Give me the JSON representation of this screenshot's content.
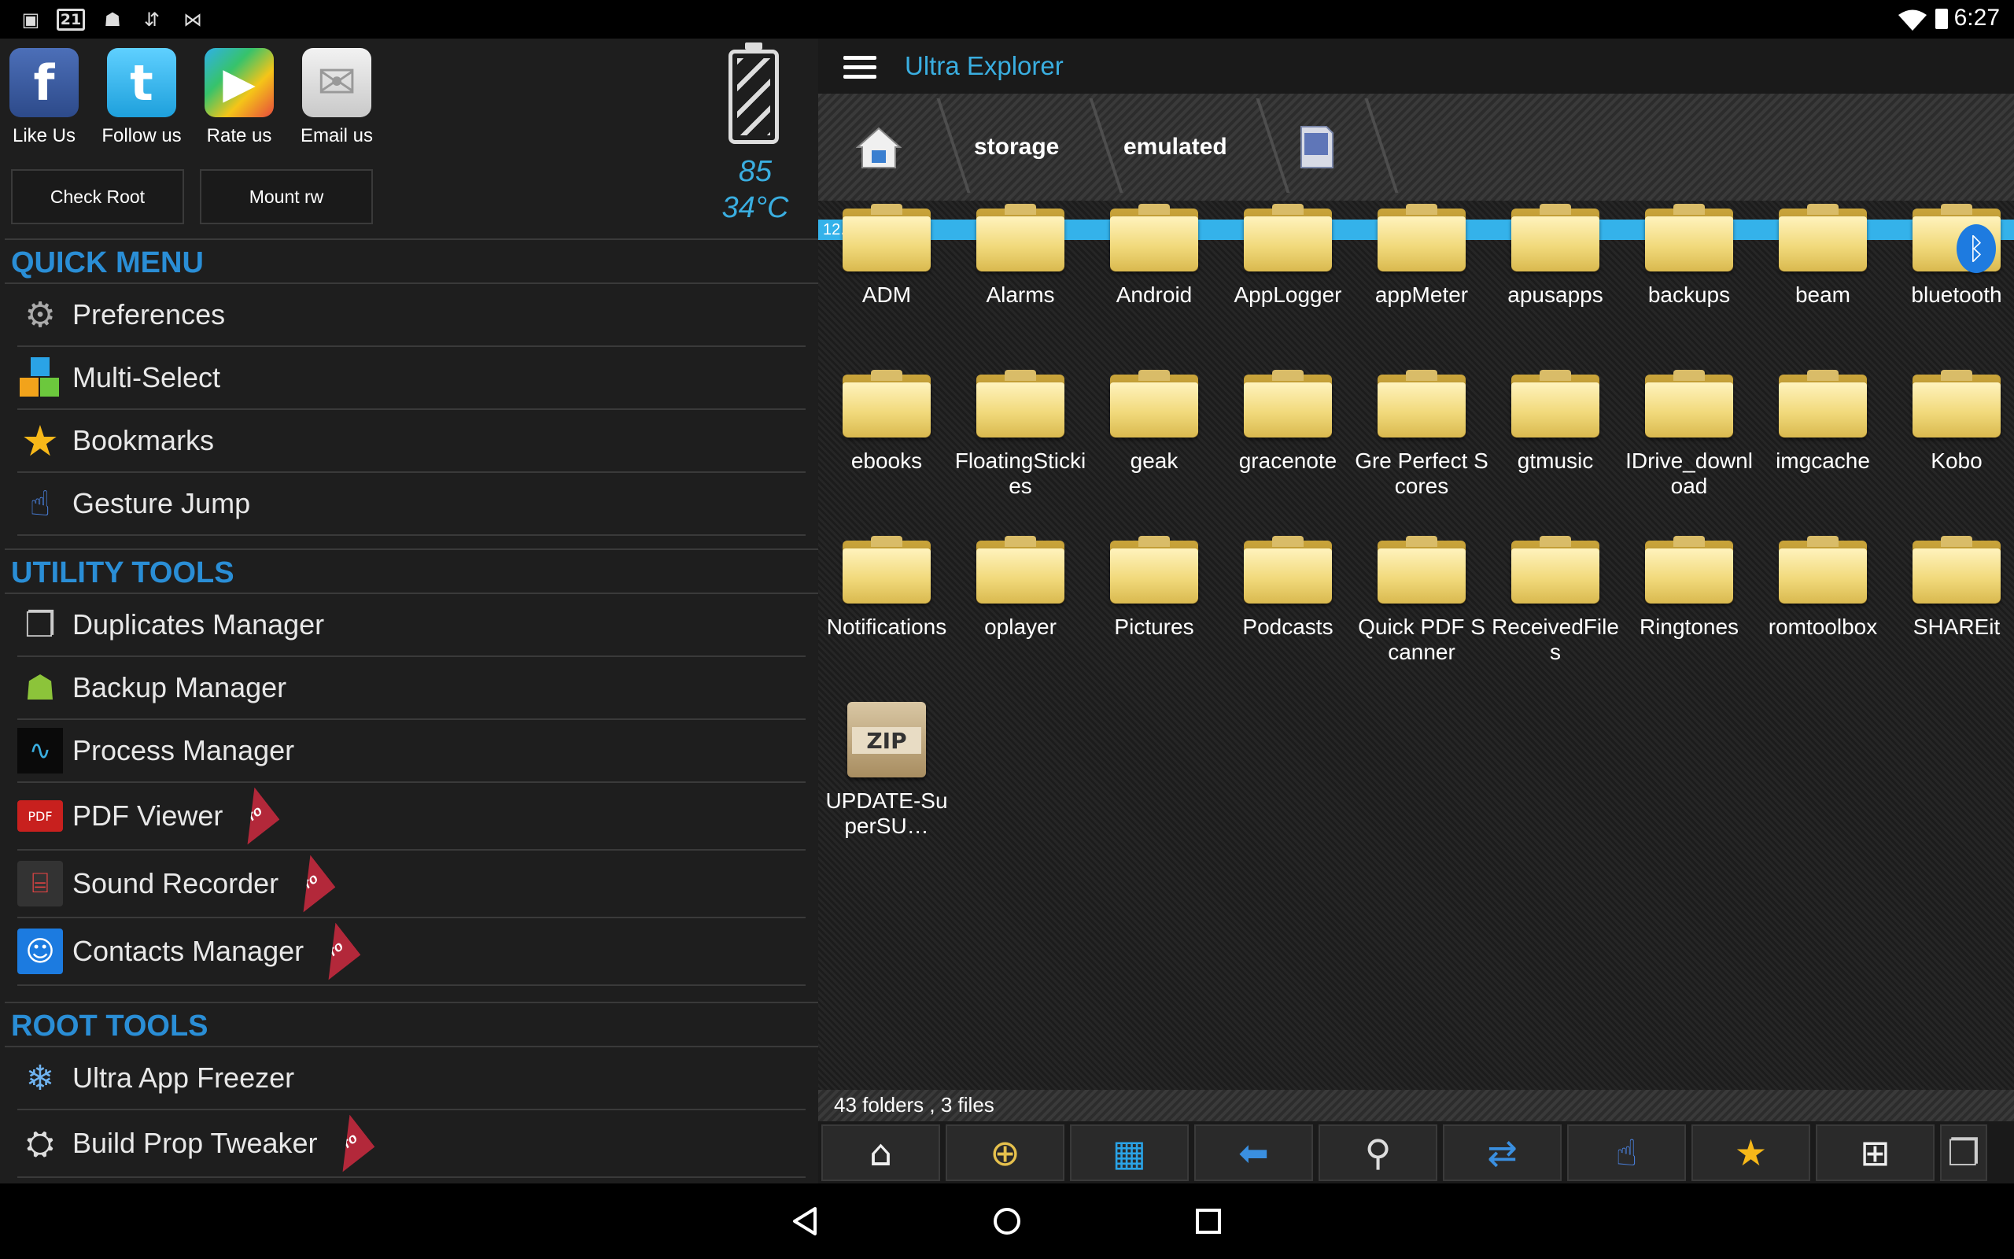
{
  "status_bar": {
    "time": "6:27",
    "notifications": [
      "image-icon",
      "calendar-icon",
      "android-icon",
      "transfer-icon",
      "bow-icon"
    ],
    "calendar_day": "21"
  },
  "left_panel": {
    "social": [
      {
        "label": "Like Us",
        "icon": "facebook-icon",
        "glyph": "f",
        "color": "#3b5998"
      },
      {
        "label": "Follow us",
        "icon": "twitter-icon",
        "glyph": "t",
        "color": "#2fb4f0"
      },
      {
        "label": "Rate us",
        "icon": "play-store-icon",
        "glyph": "▶",
        "color": "#5a9e3a"
      },
      {
        "label": "Email us",
        "icon": "email-icon",
        "glyph": "✉",
        "color": "#d8d8d8"
      }
    ],
    "check_root_label": "Check Root",
    "mount_label": "Mount rw",
    "battery_level": "85",
    "temperature": "34°C",
    "sections": [
      {
        "title": "QUICK MENU",
        "items": [
          {
            "label": "Preferences",
            "icon": "gear-icon",
            "pro": false
          },
          {
            "label": "Multi-Select",
            "icon": "blocks-icon",
            "pro": false
          },
          {
            "label": "Bookmarks",
            "icon": "star-icon",
            "pro": false
          },
          {
            "label": "Gesture Jump",
            "icon": "hand-icon",
            "pro": false
          }
        ]
      },
      {
        "title": "UTILITY TOOLS",
        "items": [
          {
            "label": "Duplicates Manager",
            "icon": "duplicates-icon",
            "pro": false
          },
          {
            "label": "Backup Manager",
            "icon": "android-icon",
            "pro": false
          },
          {
            "label": "Process Manager",
            "icon": "pulse-icon",
            "pro": false
          },
          {
            "label": "PDF Viewer",
            "icon": "pdf-icon",
            "pro": true
          },
          {
            "label": "Sound Recorder",
            "icon": "cassette-icon",
            "pro": true
          },
          {
            "label": "Contacts Manager",
            "icon": "contacts-icon",
            "pro": true
          }
        ]
      },
      {
        "title": "ROOT TOOLS",
        "items": [
          {
            "label": "Ultra App Freezer",
            "icon": "freezer-icon",
            "pro": false
          },
          {
            "label": "Build Prop Tweaker",
            "icon": "prop-icon",
            "pro": true
          }
        ]
      }
    ],
    "pro_badge": "Pro"
  },
  "right_panel": {
    "app_title": "Ultra Explorer",
    "breadcrumb": [
      {
        "type": "icon",
        "icon": "home-icon"
      },
      {
        "type": "text",
        "label": "storage"
      },
      {
        "type": "text",
        "label": "emulated"
      },
      {
        "type": "icon",
        "icon": "sd-card-icon"
      }
    ],
    "storage_used": "12.67 Gb used",
    "items": [
      {
        "name": "ADM",
        "type": "folder"
      },
      {
        "name": "Alarms",
        "type": "folder"
      },
      {
        "name": "Android",
        "type": "folder"
      },
      {
        "name": "AppLogger",
        "type": "folder"
      },
      {
        "name": "appMeter",
        "type": "folder"
      },
      {
        "name": "apusapps",
        "type": "folder"
      },
      {
        "name": "backups",
        "type": "folder"
      },
      {
        "name": "beam",
        "type": "folder"
      },
      {
        "name": "bluetooth",
        "type": "folder",
        "overlay": "bluetooth-icon"
      },
      {
        "name": "ebooks",
        "type": "folder"
      },
      {
        "name": "FloatingStickies",
        "type": "folder"
      },
      {
        "name": "geak",
        "type": "folder"
      },
      {
        "name": "gracenote",
        "type": "folder"
      },
      {
        "name": "Gre Perfect Scores",
        "type": "folder"
      },
      {
        "name": "gtmusic",
        "type": "folder"
      },
      {
        "name": "IDrive_download",
        "type": "folder"
      },
      {
        "name": "imgcache",
        "type": "folder"
      },
      {
        "name": "Kobo",
        "type": "folder"
      },
      {
        "name": "Notifications",
        "type": "folder"
      },
      {
        "name": "oplayer",
        "type": "folder"
      },
      {
        "name": "Pictures",
        "type": "folder"
      },
      {
        "name": "Podcasts",
        "type": "folder"
      },
      {
        "name": "Quick PDF Scanner",
        "type": "folder"
      },
      {
        "name": "ReceivedFiles",
        "type": "folder"
      },
      {
        "name": "Ringtones",
        "type": "folder"
      },
      {
        "name": "romtoolbox",
        "type": "folder"
      },
      {
        "name": "SHAREit",
        "type": "folder"
      },
      {
        "name": "UPDATE-SuperSU…",
        "type": "zip",
        "badge": "ZIP"
      }
    ],
    "summary": "43 folders , 3 files",
    "toolbar": [
      {
        "icon": "home-icon",
        "glyph": "⌂"
      },
      {
        "icon": "new-folder-icon",
        "glyph": "⊕"
      },
      {
        "icon": "multi-select-icon",
        "glyph": "▦"
      },
      {
        "icon": "back-arrow-icon",
        "glyph": "⬅"
      },
      {
        "icon": "search-icon",
        "glyph": "⚲"
      },
      {
        "icon": "refresh-icon",
        "glyph": "⇄"
      },
      {
        "icon": "gesture-icon",
        "glyph": "☝"
      },
      {
        "icon": "bookmark-star-icon",
        "glyph": "★"
      },
      {
        "icon": "grid-view-icon",
        "glyph": "⊞"
      },
      {
        "icon": "duplicates-icon",
        "glyph": "❐"
      }
    ]
  },
  "nav_bar": {
    "buttons": [
      "back-icon",
      "home-circle-icon",
      "recents-icon"
    ]
  }
}
